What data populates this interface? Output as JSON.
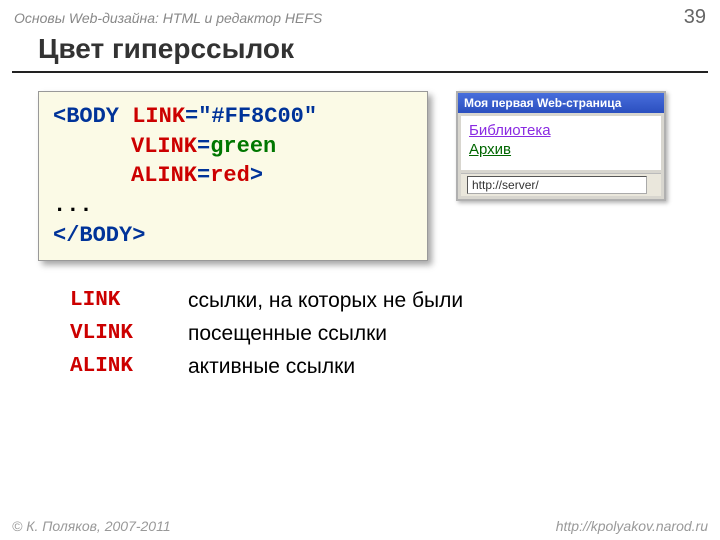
{
  "header": {
    "subtitle": "Основы Web-дизайна: HTML и редактор HEFS",
    "page": "39"
  },
  "title": "Цвет гиперссылок",
  "code": {
    "l1a": "<BODY ",
    "l1b": "LINK",
    "l1c": "=\"#FF8C00\"",
    "l2a": "VLINK",
    "l2b": "=",
    "l2c": "green",
    "l3a": "ALINK",
    "l3b": "=",
    "l3c": "red",
    "l3d": ">",
    "l4": "...",
    "l5": "</BODY>"
  },
  "browser": {
    "title": "Моя первая Web-страница",
    "link1": "Библиотека",
    "link2": "Архив",
    "status": "http://server/"
  },
  "defs": [
    {
      "t": "LINK",
      "d": "ссылки, на которых не были"
    },
    {
      "t": "VLINK",
      "d": "посещенные ссылки"
    },
    {
      "t": "ALINK",
      "d": "активные ссылки"
    }
  ],
  "footer": {
    "left": "© К. Поляков, 2007-2011",
    "right": "http://kpolyakov.narod.ru"
  }
}
